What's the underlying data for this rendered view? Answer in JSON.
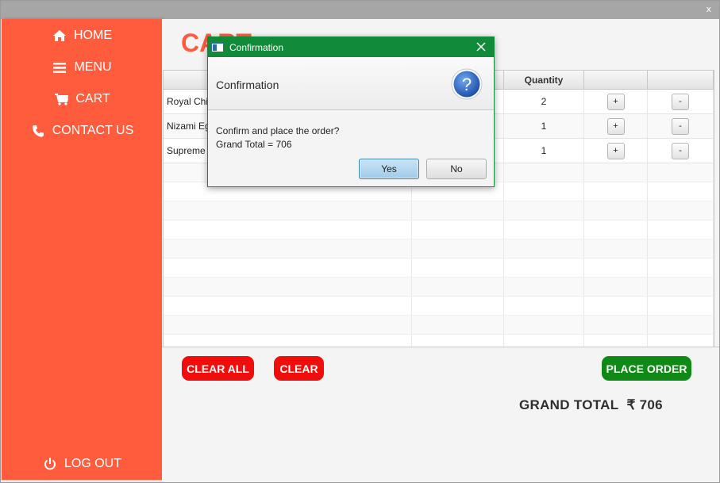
{
  "window": {
    "close_label": "x"
  },
  "sidebar": {
    "items": [
      {
        "label": "HOME",
        "icon": "home-icon"
      },
      {
        "label": "MENU",
        "icon": "menu-icon"
      },
      {
        "label": "CART",
        "icon": "cart-icon"
      },
      {
        "label": "CONTACT US",
        "icon": "phone-icon"
      }
    ],
    "logout": {
      "label": "LOG OUT",
      "icon": "power-icon"
    }
  },
  "main": {
    "title": "CART",
    "table": {
      "columns": [
        "",
        "",
        "Quantity",
        "",
        ""
      ],
      "rows": [
        {
          "name": "Royal Chic",
          "quantity": "2",
          "plus": "+",
          "minus": "-"
        },
        {
          "name": "Nizami Eg",
          "quantity": "1",
          "plus": "+",
          "minus": "-"
        },
        {
          "name": "Supreme",
          "quantity": "1",
          "plus": "+",
          "minus": "-"
        }
      ]
    },
    "buttons": {
      "clear_all": "CLEAR ALL",
      "clear": "CLEAR",
      "place_order": "PLACE ORDER"
    },
    "grand_total": {
      "label": "GRAND TOTAL",
      "amount": "₹ 706"
    }
  },
  "dialog": {
    "title": "Confirmation",
    "header": "Confirmation",
    "message_line1": "Confirm and place the order?",
    "message_line2": "Grand Total = 706",
    "yes_label": "Yes",
    "no_label": "No",
    "question_mark": "?"
  },
  "colors": {
    "sidebar": "#ff5c3e",
    "accent_red": "#f20d0d",
    "accent_green": "#0f8a16",
    "dialog_title": "#118a3a",
    "title_orange": "#ff5c3e"
  }
}
